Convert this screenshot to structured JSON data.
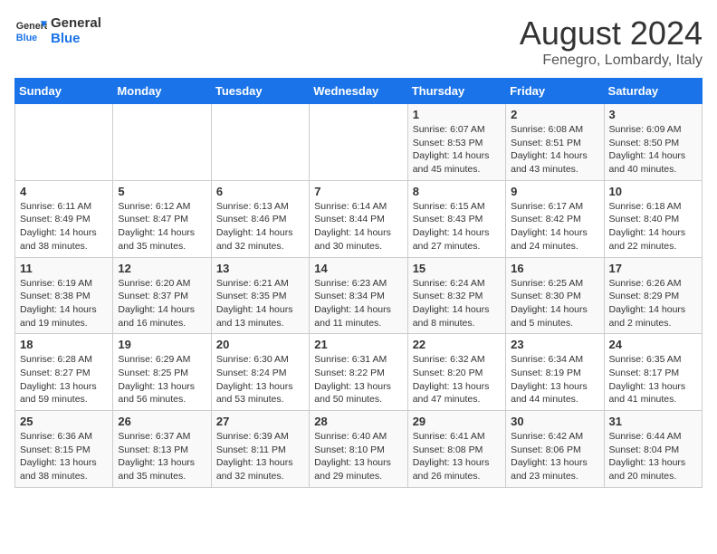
{
  "header": {
    "logo_line1": "General",
    "logo_line2": "Blue",
    "month_year": "August 2024",
    "location": "Fenegro, Lombardy, Italy"
  },
  "days_of_week": [
    "Sunday",
    "Monday",
    "Tuesday",
    "Wednesday",
    "Thursday",
    "Friday",
    "Saturday"
  ],
  "weeks": [
    [
      {
        "day": "",
        "info": ""
      },
      {
        "day": "",
        "info": ""
      },
      {
        "day": "",
        "info": ""
      },
      {
        "day": "",
        "info": ""
      },
      {
        "day": "1",
        "info": "Sunrise: 6:07 AM\nSunset: 8:53 PM\nDaylight: 14 hours\nand 45 minutes."
      },
      {
        "day": "2",
        "info": "Sunrise: 6:08 AM\nSunset: 8:51 PM\nDaylight: 14 hours\nand 43 minutes."
      },
      {
        "day": "3",
        "info": "Sunrise: 6:09 AM\nSunset: 8:50 PM\nDaylight: 14 hours\nand 40 minutes."
      }
    ],
    [
      {
        "day": "4",
        "info": "Sunrise: 6:11 AM\nSunset: 8:49 PM\nDaylight: 14 hours\nand 38 minutes."
      },
      {
        "day": "5",
        "info": "Sunrise: 6:12 AM\nSunset: 8:47 PM\nDaylight: 14 hours\nand 35 minutes."
      },
      {
        "day": "6",
        "info": "Sunrise: 6:13 AM\nSunset: 8:46 PM\nDaylight: 14 hours\nand 32 minutes."
      },
      {
        "day": "7",
        "info": "Sunrise: 6:14 AM\nSunset: 8:44 PM\nDaylight: 14 hours\nand 30 minutes."
      },
      {
        "day": "8",
        "info": "Sunrise: 6:15 AM\nSunset: 8:43 PM\nDaylight: 14 hours\nand 27 minutes."
      },
      {
        "day": "9",
        "info": "Sunrise: 6:17 AM\nSunset: 8:42 PM\nDaylight: 14 hours\nand 24 minutes."
      },
      {
        "day": "10",
        "info": "Sunrise: 6:18 AM\nSunset: 8:40 PM\nDaylight: 14 hours\nand 22 minutes."
      }
    ],
    [
      {
        "day": "11",
        "info": "Sunrise: 6:19 AM\nSunset: 8:38 PM\nDaylight: 14 hours\nand 19 minutes."
      },
      {
        "day": "12",
        "info": "Sunrise: 6:20 AM\nSunset: 8:37 PM\nDaylight: 14 hours\nand 16 minutes."
      },
      {
        "day": "13",
        "info": "Sunrise: 6:21 AM\nSunset: 8:35 PM\nDaylight: 14 hours\nand 13 minutes."
      },
      {
        "day": "14",
        "info": "Sunrise: 6:23 AM\nSunset: 8:34 PM\nDaylight: 14 hours\nand 11 minutes."
      },
      {
        "day": "15",
        "info": "Sunrise: 6:24 AM\nSunset: 8:32 PM\nDaylight: 14 hours\nand 8 minutes."
      },
      {
        "day": "16",
        "info": "Sunrise: 6:25 AM\nSunset: 8:30 PM\nDaylight: 14 hours\nand 5 minutes."
      },
      {
        "day": "17",
        "info": "Sunrise: 6:26 AM\nSunset: 8:29 PM\nDaylight: 14 hours\nand 2 minutes."
      }
    ],
    [
      {
        "day": "18",
        "info": "Sunrise: 6:28 AM\nSunset: 8:27 PM\nDaylight: 13 hours\nand 59 minutes."
      },
      {
        "day": "19",
        "info": "Sunrise: 6:29 AM\nSunset: 8:25 PM\nDaylight: 13 hours\nand 56 minutes."
      },
      {
        "day": "20",
        "info": "Sunrise: 6:30 AM\nSunset: 8:24 PM\nDaylight: 13 hours\nand 53 minutes."
      },
      {
        "day": "21",
        "info": "Sunrise: 6:31 AM\nSunset: 8:22 PM\nDaylight: 13 hours\nand 50 minutes."
      },
      {
        "day": "22",
        "info": "Sunrise: 6:32 AM\nSunset: 8:20 PM\nDaylight: 13 hours\nand 47 minutes."
      },
      {
        "day": "23",
        "info": "Sunrise: 6:34 AM\nSunset: 8:19 PM\nDaylight: 13 hours\nand 44 minutes."
      },
      {
        "day": "24",
        "info": "Sunrise: 6:35 AM\nSunset: 8:17 PM\nDaylight: 13 hours\nand 41 minutes."
      }
    ],
    [
      {
        "day": "25",
        "info": "Sunrise: 6:36 AM\nSunset: 8:15 PM\nDaylight: 13 hours\nand 38 minutes."
      },
      {
        "day": "26",
        "info": "Sunrise: 6:37 AM\nSunset: 8:13 PM\nDaylight: 13 hours\nand 35 minutes."
      },
      {
        "day": "27",
        "info": "Sunrise: 6:39 AM\nSunset: 8:11 PM\nDaylight: 13 hours\nand 32 minutes."
      },
      {
        "day": "28",
        "info": "Sunrise: 6:40 AM\nSunset: 8:10 PM\nDaylight: 13 hours\nand 29 minutes."
      },
      {
        "day": "29",
        "info": "Sunrise: 6:41 AM\nSunset: 8:08 PM\nDaylight: 13 hours\nand 26 minutes."
      },
      {
        "day": "30",
        "info": "Sunrise: 6:42 AM\nSunset: 8:06 PM\nDaylight: 13 hours\nand 23 minutes."
      },
      {
        "day": "31",
        "info": "Sunrise: 6:44 AM\nSunset: 8:04 PM\nDaylight: 13 hours\nand 20 minutes."
      }
    ]
  ]
}
